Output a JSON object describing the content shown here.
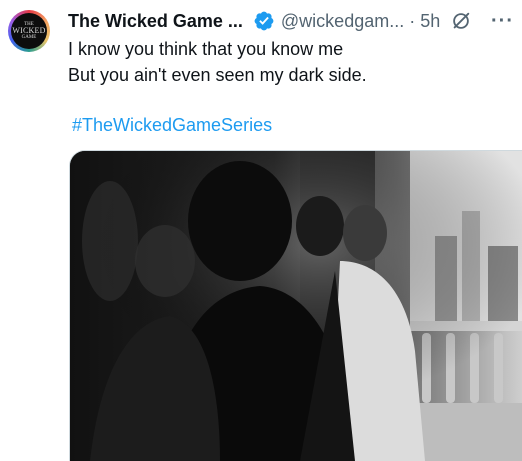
{
  "avatar": {
    "line1": "THE",
    "line2": "WICKED",
    "line3": "GAME"
  },
  "header": {
    "display_name": "The Wicked Game ...",
    "handle": "@wickedgam...",
    "separator": "·",
    "time": "5h",
    "more_label": "···"
  },
  "tweet": {
    "line1": "I know you think that you know me",
    "line2": "But you ain't even seen my dark side.",
    "hashtag": "#TheWickedGameSeries"
  },
  "icons": {
    "verified": "verified-badge-icon",
    "grok": "grok-icon",
    "more": "more-options-icon"
  },
  "colors": {
    "verified_blue": "#1d9bf0",
    "hashtag_blue": "#1d9bf0",
    "secondary_text": "#536471"
  }
}
